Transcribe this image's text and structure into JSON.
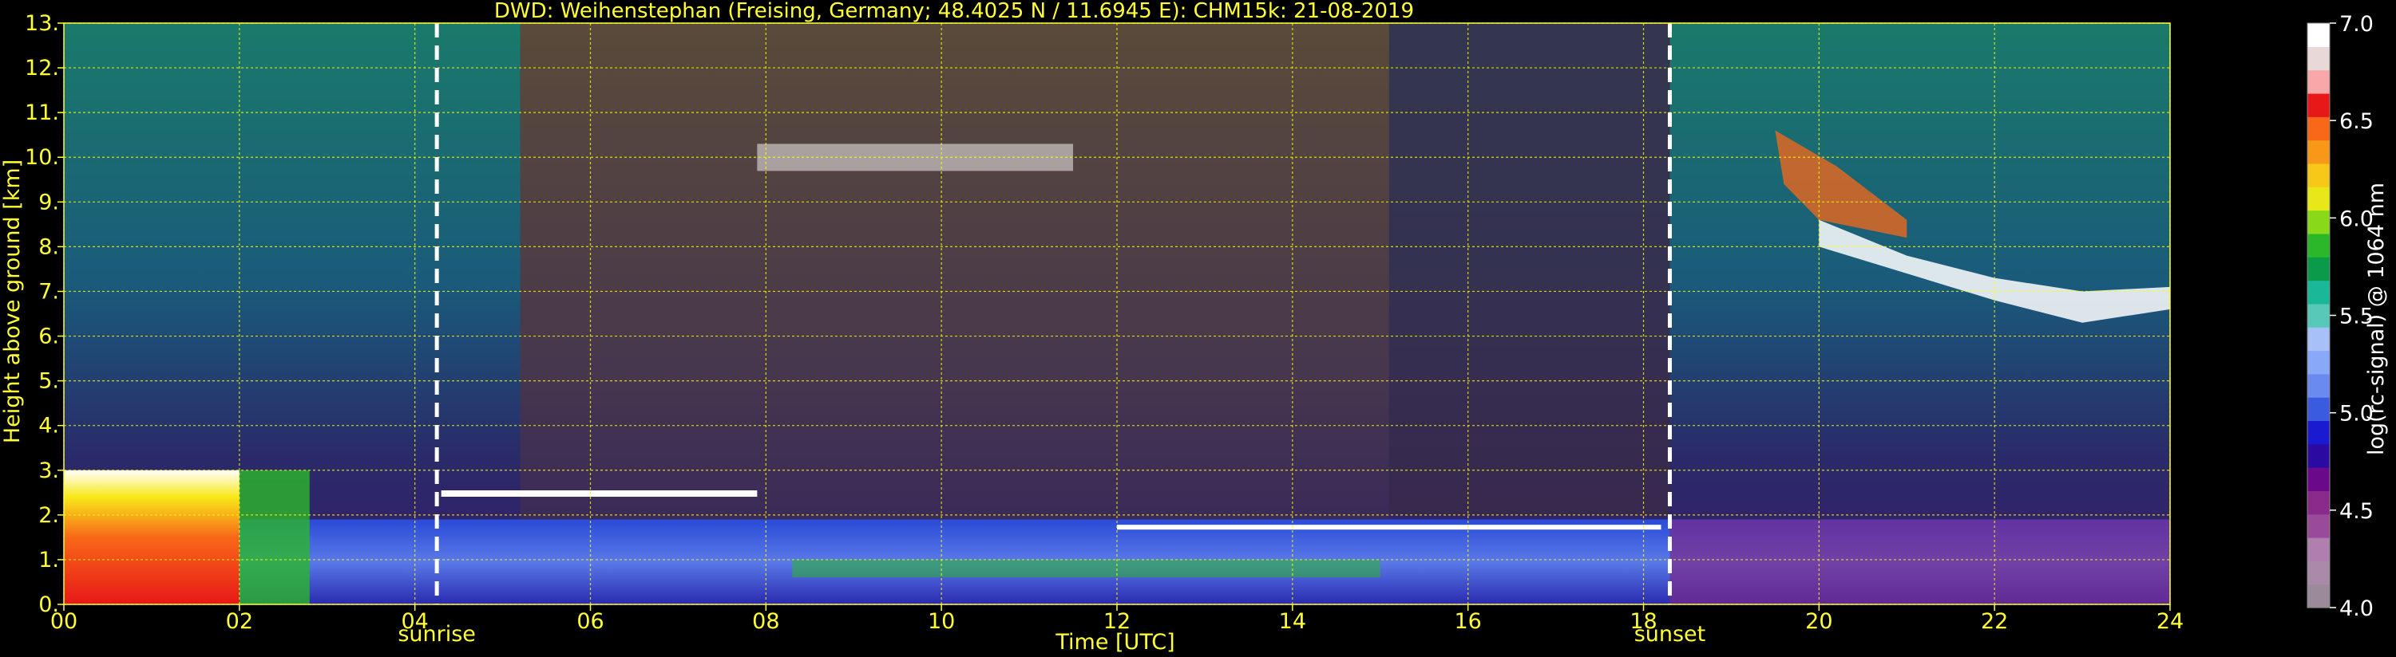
{
  "chart_data": {
    "type": "heatmap",
    "title": "DWD: Weihenstephan (Freising, Germany; 48.4025 N / 11.6945 E):    CHM15k: 21-08-2019",
    "xlabel": "Time [UTC]",
    "ylabel": "Height above ground [km]",
    "xlim": [
      0,
      24
    ],
    "ylim": [
      0,
      13
    ],
    "x_ticks": [
      "00",
      "02",
      "04",
      "06",
      "08",
      "10",
      "12",
      "14",
      "16",
      "18",
      "20",
      "22",
      "24"
    ],
    "y_ticks": [
      "0.",
      "1.",
      "2.",
      "3.",
      "4.",
      "5.",
      "6.",
      "7.",
      "8.",
      "9.",
      "10.",
      "11.",
      "12.",
      "13."
    ],
    "grid": true,
    "grid_color": "#ffff00",
    "background": "#000000",
    "markers": [
      {
        "label": "sunrise",
        "x": 4.25
      },
      {
        "label": "sunset",
        "x": 18.3
      }
    ],
    "colorbar": {
      "label": "log(rc-signal) @ 1064 nm",
      "range": [
        4.0,
        7.0
      ],
      "ticks": [
        "4.0",
        "4.5",
        "5.0",
        "5.5",
        "6.0",
        "6.5",
        "7.0"
      ],
      "colors": [
        "#9a8a9a",
        "#a98aa8",
        "#b07fb0",
        "#9a4a9a",
        "#8a2a8a",
        "#6a0a8a",
        "#2a0aa0",
        "#1a1ad0",
        "#3a5ae0",
        "#6a8af0",
        "#8aa8f8",
        "#a8c0f8",
        "#58c8b8",
        "#18b898",
        "#0a9a4a",
        "#2ab82a",
        "#8ad81a",
        "#e8e818",
        "#f8c818",
        "#f89818",
        "#f86818",
        "#e81818",
        "#f8a8a8",
        "#e8d8d8",
        "#ffffff"
      ]
    }
  }
}
